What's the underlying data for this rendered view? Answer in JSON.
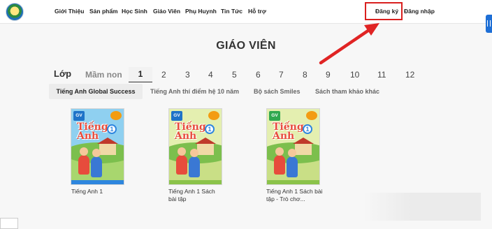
{
  "header": {
    "nav": [
      "Giới Thiệu",
      "Sản phẩm",
      "Học Sinh",
      "Giáo Viên",
      "Phụ Huynh",
      "Tin Tức",
      "Hỗ trợ"
    ],
    "register_label": "Đăng ký",
    "login_label": "Đăng nhập"
  },
  "page": {
    "title": "GIÁO VIÊN",
    "grade_label": "Lớp",
    "grades": [
      "Mầm non",
      "1",
      "2",
      "3",
      "4",
      "5",
      "6",
      "7",
      "8",
      "9",
      "10",
      "11",
      "12"
    ],
    "selected_grade": "1",
    "series": [
      "Tiếng Anh Global Success",
      "Tiếng Anh thí điểm hệ 10 năm",
      "Bộ sách Smiles",
      "Sách tham khảo khác"
    ],
    "selected_series": "Tiếng Anh Global Success"
  },
  "books": [
    {
      "title": "Tiếng Anh 1",
      "badge": "GV",
      "cover_title": "Tiếng Anh",
      "grade": "1",
      "sky": "#8fd0f0",
      "ground": "#a8d66e",
      "strip": "#2e86de"
    },
    {
      "title": "Tiếng Anh 1 Sách bài tập",
      "badge": "GV",
      "cover_title": "Tiếng Anh",
      "grade": "1",
      "sky": "#e4efb0",
      "ground": "#c9df86",
      "strip": "#8bc34a"
    },
    {
      "title": "Tiếng Anh 1 Sách bài tập - Trò chơ...",
      "badge": "GV",
      "cover_title": "Tiếng Anh",
      "grade": "1",
      "sky": "#e4efb0",
      "ground": "#c9df86",
      "strip": "#8bc34a"
    }
  ],
  "colors": {
    "highlight": "#d9201f",
    "arrow": "#e02424",
    "edge_tab": "#1e6fd6"
  }
}
